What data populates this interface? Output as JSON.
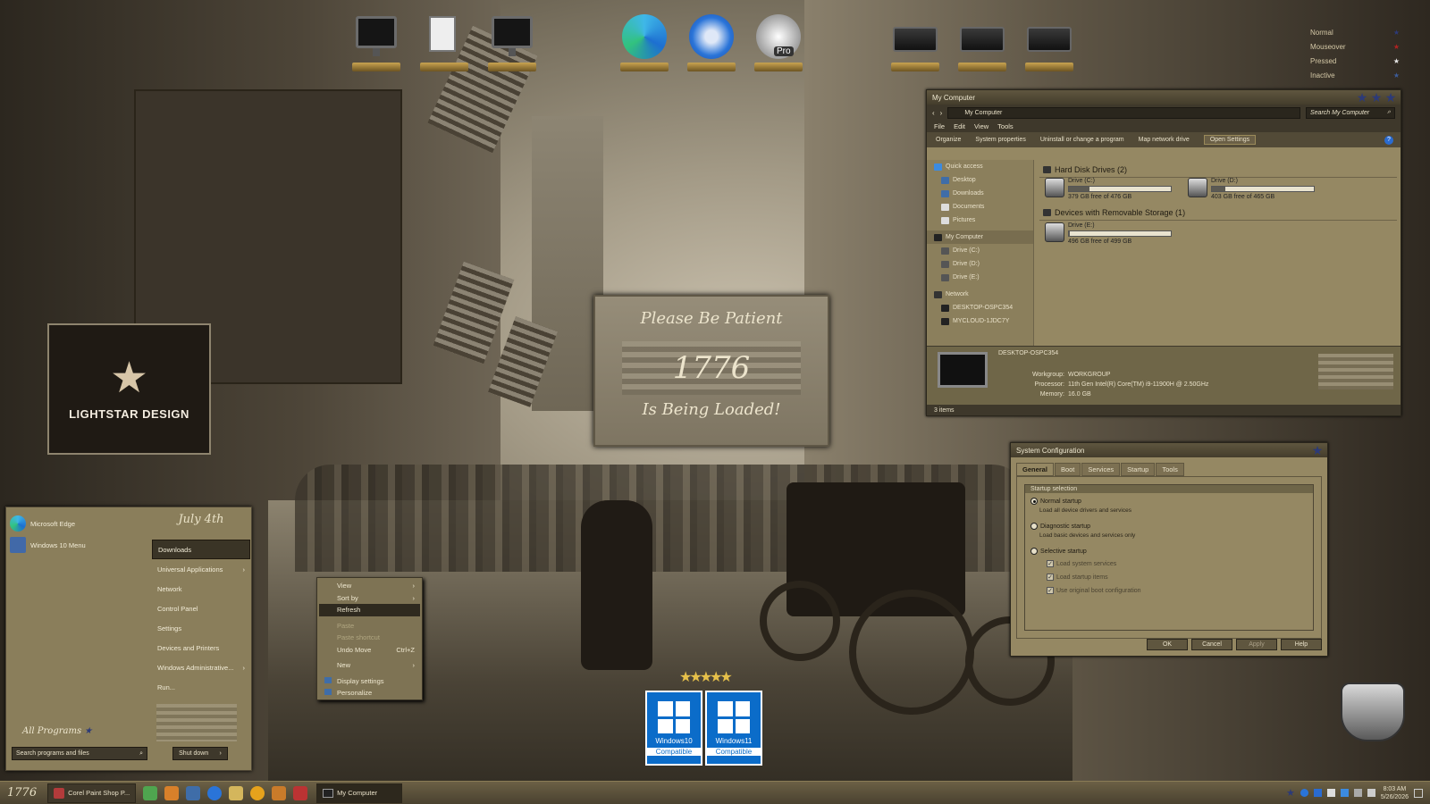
{
  "desktop": {
    "dock_left": [
      "computer-icon",
      "documents-icon",
      "network-icon"
    ],
    "dock_center": [
      "edge-icon",
      "thunderbird-icon",
      "google-earth-pro-icon"
    ],
    "dock_center_pro_label": "Pro",
    "dock_right": [
      "drive-icon",
      "drive-icon",
      "drive-icon"
    ]
  },
  "legend": {
    "items": [
      {
        "label": "Normal",
        "color": "#2c3a78"
      },
      {
        "label": "Mouseover",
        "color": "#b22222"
      },
      {
        "label": "Pressed",
        "color": "#e8e8e8"
      },
      {
        "label": "Inactive",
        "color": "#3c5c9a"
      }
    ]
  },
  "plaque": {
    "line1": "Please Be Patient",
    "line2": "1776",
    "line3": "Is Being Loaded!"
  },
  "logo": {
    "text": "LIGHTSTAR DESIGN"
  },
  "explorer": {
    "title": "My Computer",
    "address": "My Computer",
    "search_placeholder": "Search My Computer",
    "menu": [
      "File",
      "Edit",
      "View",
      "Tools"
    ],
    "commands": [
      "Organize",
      "System properties",
      "Uninstall or change a program",
      "Map network drive",
      "Open Settings"
    ],
    "nav": {
      "quick_access": "Quick access",
      "desktop": "Desktop",
      "downloads": "Downloads",
      "documents": "Documents",
      "pictures": "Pictures",
      "my_computer": "My Computer",
      "drive_c": "Drive (C:)",
      "drive_d": "Drive (D:)",
      "drive_e": "Drive (E:)",
      "network": "Network",
      "pc1": "DESKTOP-OSPC354",
      "pc2": "MYCLOUD-1JDC7Y"
    },
    "group_hdd": "Hard Disk Drives (2)",
    "group_removable": "Devices with Removable Storage (1)",
    "drives": [
      {
        "name": "Drive (C:)",
        "free": "379 GB free of 476 GB",
        "used_fraction": 0.2
      },
      {
        "name": "Drive (D:)",
        "free": "403 GB free of 465 GB",
        "used_fraction": 0.13
      },
      {
        "name": "Drive (E:)",
        "free": "496 GB free of 499 GB",
        "used_fraction": 0.01
      }
    ],
    "details": {
      "computer_name": "DESKTOP-OSPC354",
      "workgroup_label": "Workgroup:",
      "workgroup": "WORKGROUP",
      "processor_label": "Processor:",
      "processor": "11th Gen Intel(R) Core(TM) i9-11900H @ 2.50GHz",
      "memory_label": "Memory:",
      "memory": "16.0 GB"
    },
    "status": "3 items"
  },
  "sysconfig": {
    "title": "System Configuration",
    "tabs": [
      "General",
      "Boot",
      "Services",
      "Startup",
      "Tools"
    ],
    "group": "Startup selection",
    "normal": "Normal startup",
    "normal_sub": "Load all device drivers and services",
    "diagnostic": "Diagnostic startup",
    "diagnostic_sub": "Load basic devices and services only",
    "selective": "Selective startup",
    "chk1": "Load system services",
    "chk2": "Load startup items",
    "chk3": "Use original boot configuration",
    "buttons": {
      "ok": "OK",
      "cancel": "Cancel",
      "apply": "Apply",
      "help": "Help"
    }
  },
  "startmenu": {
    "pinned": [
      "Microsoft Edge",
      "Windows 10 Menu"
    ],
    "header": "July 4th",
    "items": [
      "Downloads",
      "Universal Applications",
      "Network",
      "Control Panel",
      "Settings",
      "Devices and Printers",
      "Windows Administrative...",
      "Run..."
    ],
    "all_programs": "All Programs",
    "search_placeholder": "Search programs and files",
    "shutdown": "Shut down"
  },
  "context_menu": {
    "view": "View",
    "sort_by": "Sort by",
    "refresh": "Refresh",
    "paste": "Paste",
    "paste_shortcut": "Paste shortcut",
    "undo_move": "Undo Move",
    "undo_shortcut": "Ctrl+Z",
    "new": "New",
    "display_settings": "Display settings",
    "personalize": "Personalize"
  },
  "compat": [
    {
      "label": "Windows10",
      "sub": "Compatible"
    },
    {
      "label": "Windows11",
      "sub": "Compatible"
    }
  ],
  "taskbar": {
    "start_label": "1776",
    "paint_shop": "Corel Paint Shop P...",
    "my_computer": "My Computer",
    "time": "8:03 AM",
    "date": "5/26/2026"
  }
}
